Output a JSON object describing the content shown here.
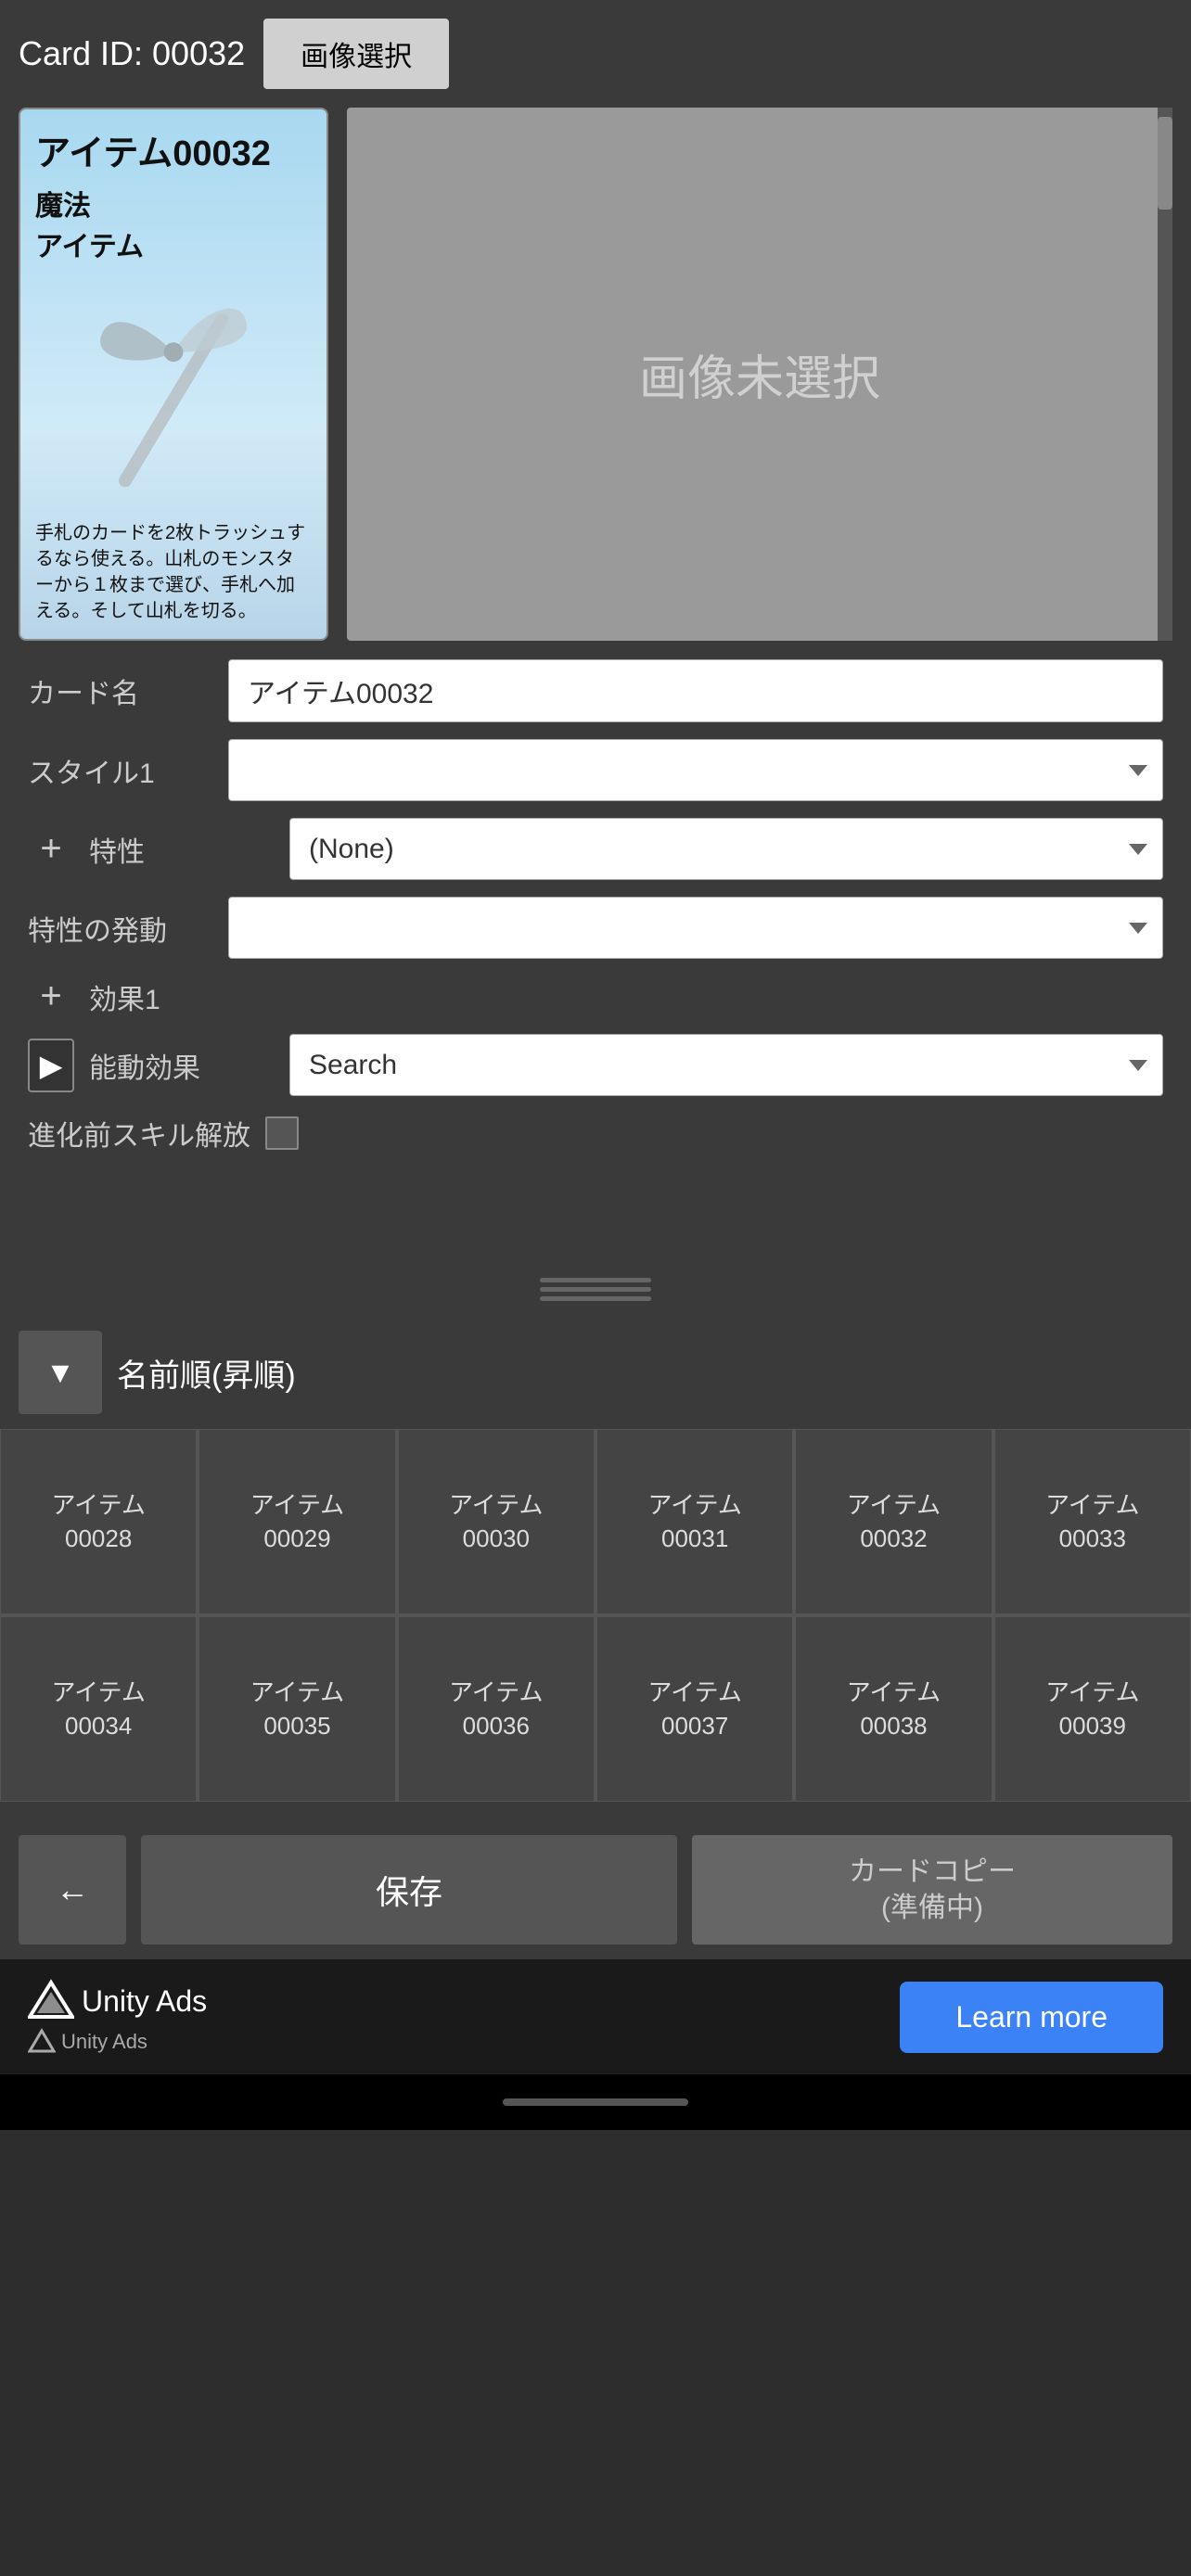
{
  "header": {
    "card_id_label": "Card ID: 00032",
    "image_select_btn": "画像選択"
  },
  "card_preview": {
    "title": "アイテム00032",
    "type1": "魔法",
    "type2": "アイテム",
    "description": "手札のカードを2枚トラッシュするなら使える。山札のモンスターから１枚まで選び、手札へ加える。そして山札を切る。"
  },
  "no_image": {
    "text": "画像未選択"
  },
  "form": {
    "card_name_label": "カード名",
    "card_name_value": "アイテム00032",
    "style1_label": "スタイル1",
    "style1_value": "",
    "trait_label": "特性",
    "trait_value": "(None)",
    "trait_trigger_label": "特性の発動",
    "trait_trigger_value": "",
    "effect1_label": "効果1",
    "active_effect_label": "能動効果",
    "active_effect_value": "Search",
    "evolve_label": "進化前スキル解放"
  },
  "sort": {
    "sort_label": "名前順(昇順)",
    "sort_icon": "▼"
  },
  "grid": {
    "rows": [
      [
        {
          "name": "アイテム\n00028"
        },
        {
          "name": "アイテム\n00029"
        },
        {
          "name": "アイテム\n00030"
        },
        {
          "name": "アイテム\n00031"
        },
        {
          "name": "アイテム\n00032"
        },
        {
          "name": "アイテム\n00033"
        }
      ],
      [
        {
          "name": "アイテム\n00034"
        },
        {
          "name": "アイテム\n00035"
        },
        {
          "name": "アイテム\n00036"
        },
        {
          "name": "アイテム\n00037"
        },
        {
          "name": "アイテム\n00038"
        },
        {
          "name": "アイテム\n00039"
        }
      ]
    ]
  },
  "bottom_buttons": {
    "back_label": "←",
    "save_label": "保存",
    "copy_label": "カードコピー\n(準備中)"
  },
  "ad": {
    "brand": "Unity Ads",
    "sub_brand": "Unity  Ads",
    "learn_more": "Learn more"
  }
}
